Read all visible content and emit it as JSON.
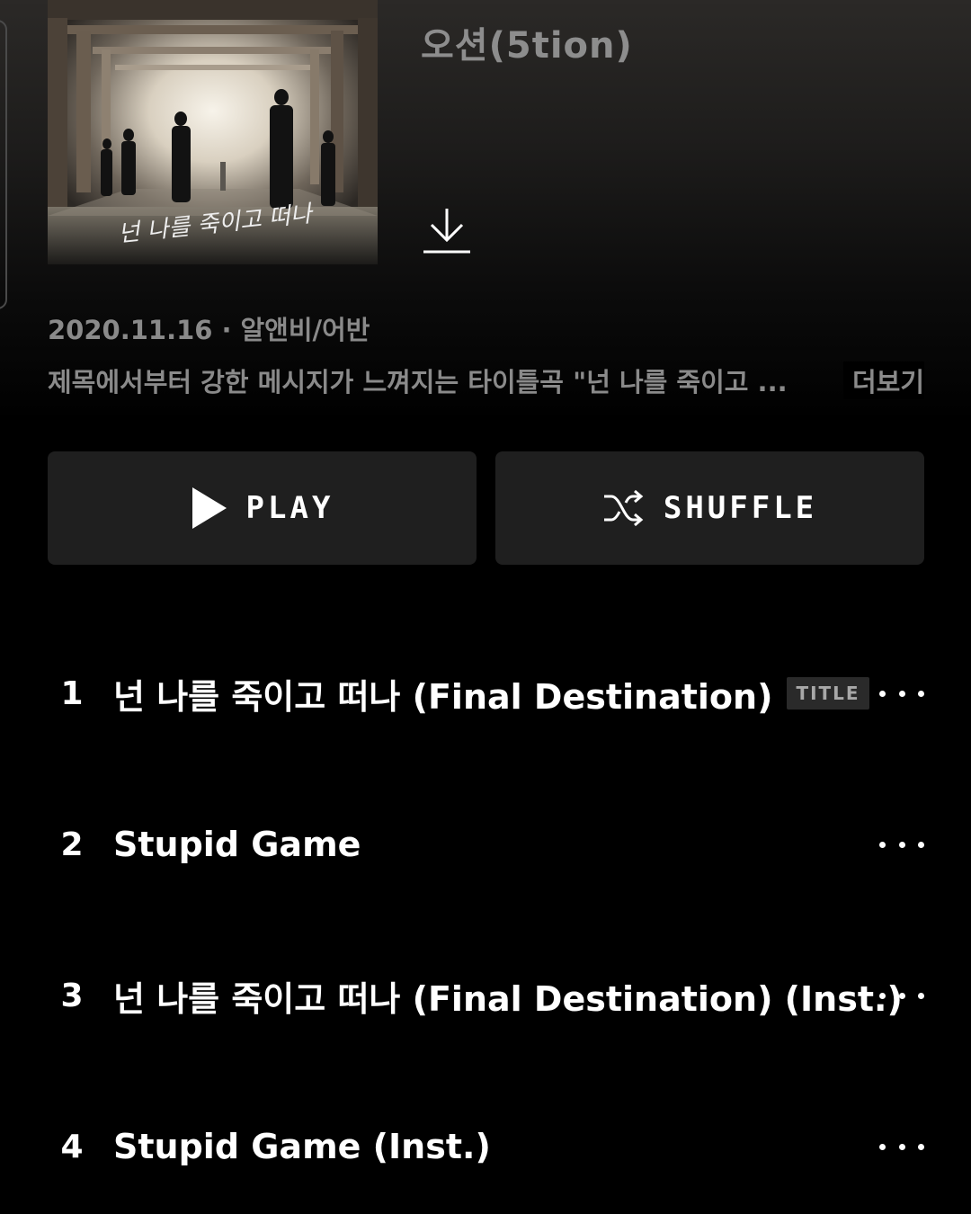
{
  "album": {
    "artist": "오션(5tion)",
    "date": "2020.11.16",
    "genre": "알앤비/어반",
    "description": "제목에서부터 강한 메시지가 느껴지는 타이틀곡 \"넌 나를 죽이고 ...",
    "more_label": "더보기",
    "cover_text": "넌 나를 죽이고 떠나"
  },
  "actions": {
    "play_label": "PLAY",
    "shuffle_label": "SHUFFLE"
  },
  "tracks": [
    {
      "number": "1",
      "title": "넌 나를 죽이고 떠나 (Final Destination)",
      "badge": "TITLE"
    },
    {
      "number": "2",
      "title": "Stupid Game"
    },
    {
      "number": "3",
      "title": "넌 나를 죽이고 떠나 (Final Destination) (Inst.)"
    },
    {
      "number": "4",
      "title": "Stupid Game (Inst.)"
    }
  ],
  "icons": {
    "download": "download-icon",
    "play": "play-icon",
    "shuffle": "shuffle-icon",
    "more": "more-icon"
  }
}
